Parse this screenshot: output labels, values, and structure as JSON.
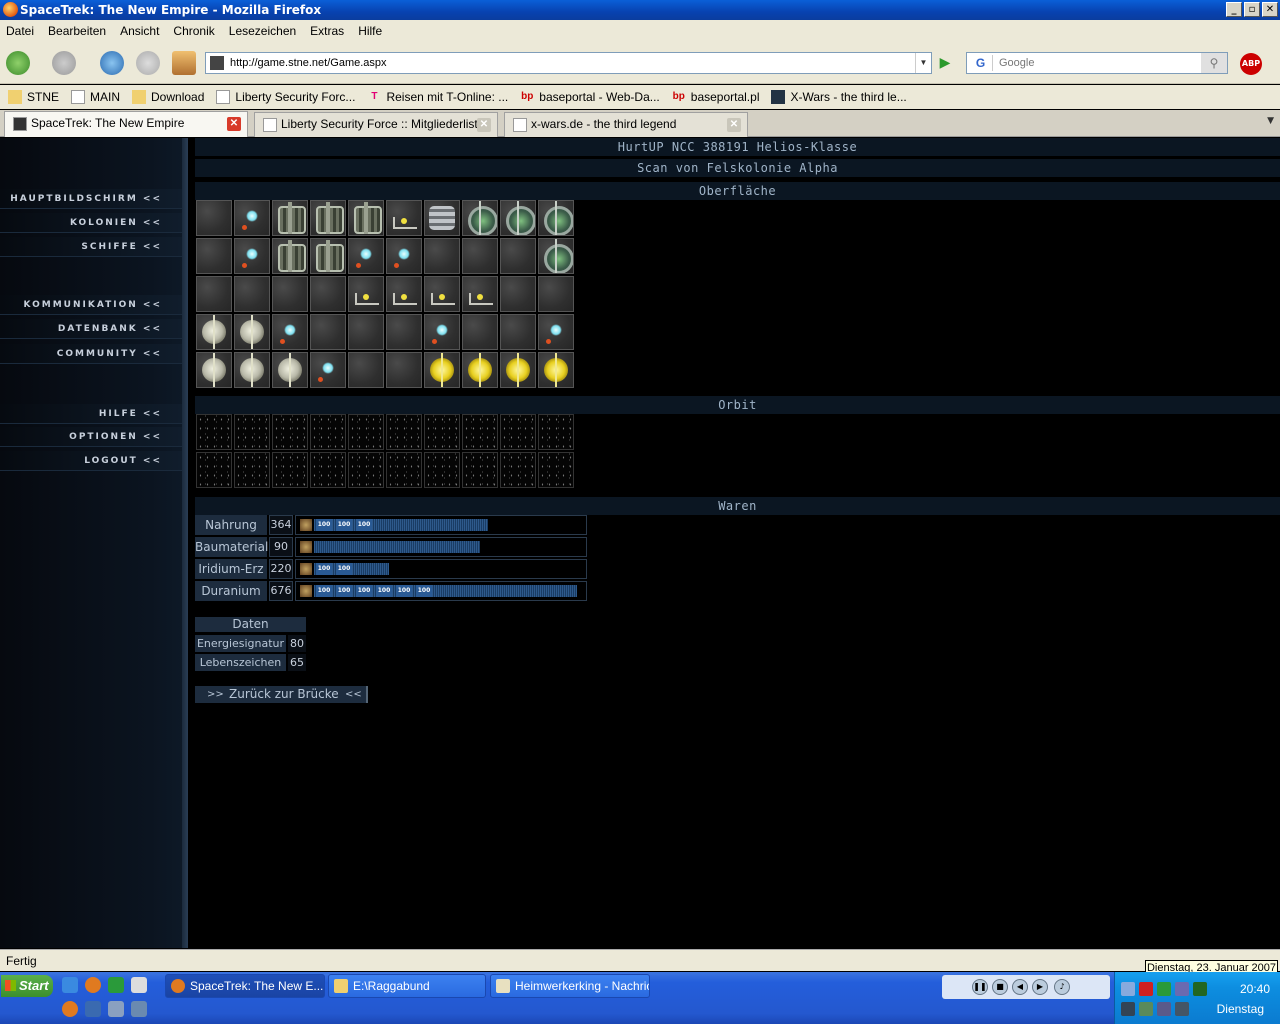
{
  "window": {
    "title": "SpaceTrek: The New Empire - Mozilla Firefox"
  },
  "menu": [
    "Datei",
    "Bearbeiten",
    "Ansicht",
    "Chronik",
    "Lesezeichen",
    "Extras",
    "Hilfe"
  ],
  "nav": {
    "url": "http://game.stne.net/Game.aspx",
    "search_placeholder": "Google"
  },
  "bookmarks": [
    "STNE",
    "MAIN",
    "Download",
    "Liberty Security Forc...",
    "Reisen mit T-Online: ...",
    "baseportal - Web-Da...",
    "baseportal.pl",
    "X-Wars - the third le..."
  ],
  "tabs": [
    "SpaceTrek: The New Empire",
    "Liberty Security Force :: Mitgliederliste",
    "x-wars.de - the third legend"
  ],
  "sidebar": {
    "items": [
      "HAUPTBILDSCHIRM <<",
      "KOLONIEN <<",
      "SCHIFFE <<",
      "KOMMUNIKATION <<",
      "DATENBANK <<",
      "COMMUNITY <<",
      "HILFE <<",
      "OPTIONEN <<",
      "LOGOUT <<"
    ]
  },
  "page": {
    "ship": "HurtUP NCC 388191 Helios-Klasse",
    "scan": "Scan von Felskolonie Alpha",
    "surface_title": "Oberfläche",
    "orbit_title": "Orbit",
    "goods_title": "Waren",
    "surface": [
      [
        "empty",
        "crystal",
        "gear",
        "gear",
        "gear",
        "lab",
        "tower",
        "ring",
        "ring",
        "ring"
      ],
      [
        "empty",
        "crystal",
        "gear",
        "gear",
        "crystal",
        "crystal",
        "empty",
        "empty",
        "empty",
        "ring"
      ],
      [
        "empty",
        "empty",
        "empty",
        "empty",
        "lab",
        "lab",
        "lab",
        "lab",
        "empty",
        "empty"
      ],
      [
        "dome",
        "dome",
        "crystal",
        "empty",
        "empty",
        "empty",
        "crystal",
        "empty",
        "empty",
        "crystal"
      ],
      [
        "dome",
        "dome",
        "dome",
        "crystal",
        "empty",
        "empty",
        "sun",
        "sun",
        "sun",
        "sun"
      ]
    ],
    "orbit_rows": 2,
    "goods": [
      {
        "name": "Nahrung",
        "amount": "364",
        "bar": 0.65,
        "segments": [
          "100",
          "100",
          "100"
        ]
      },
      {
        "name": "Baumaterial",
        "amount": "90",
        "bar": 0.62,
        "segments": []
      },
      {
        "name": "Iridium-Erz",
        "amount": "220",
        "bar": 0.28,
        "segments": [
          "100",
          "100"
        ]
      },
      {
        "name": "Duranium",
        "amount": "676",
        "bar": 0.98,
        "segments": [
          "100",
          "100",
          "100",
          "100",
          "100",
          "100"
        ]
      }
    ],
    "data_title": "Daten",
    "data": [
      {
        "label": "Energiesignatur",
        "value": "80"
      },
      {
        "label": "Lebenszeichen",
        "value": "65"
      }
    ],
    "back": {
      "left": ">>",
      "label": "Zurück zur Brücke",
      "right": "<<"
    }
  },
  "status": "Fertig",
  "tooltip": "Dienstag, 23. Januar 2007",
  "taskbar": {
    "start": "Start",
    "buttons": [
      "SpaceTrek: The New E...",
      "E:\\Raggabund",
      "Heimwerkerking - Nachric..."
    ],
    "time": "20:40",
    "day": "Dienstag"
  }
}
